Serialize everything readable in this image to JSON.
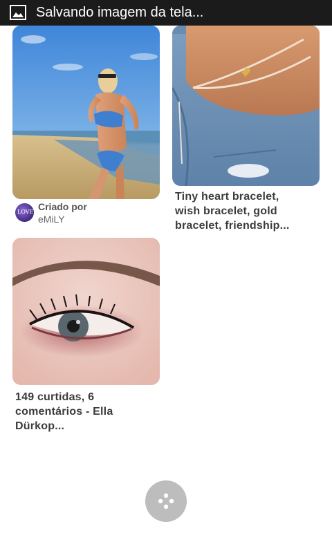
{
  "statusbar": {
    "icon": "image-icon",
    "title": "Salvando imagem da tela..."
  },
  "pins": [
    {
      "image": "beach-bikini-photo",
      "creator_prefix": "Criado por",
      "creator_name": "eMiLY",
      "avatar_text": "LOVE"
    },
    {
      "image": "bracelet-photo",
      "description_lines": [
        "Tiny heart bracelet,",
        "wish bracelet, gold",
        "bracelet, friendship..."
      ]
    },
    {
      "image": "eye-makeup-photo",
      "description_lines": [
        "149 curtidas, 6",
        "comentários - Ella",
        "Dürkop..."
      ]
    }
  ],
  "fab": {
    "icon": "dots-cluster-icon"
  },
  "colors": {
    "statusbar_bg": "#1b1b1b",
    "fab_bg": "#bdbdbd",
    "text": "#3b3b3b"
  }
}
